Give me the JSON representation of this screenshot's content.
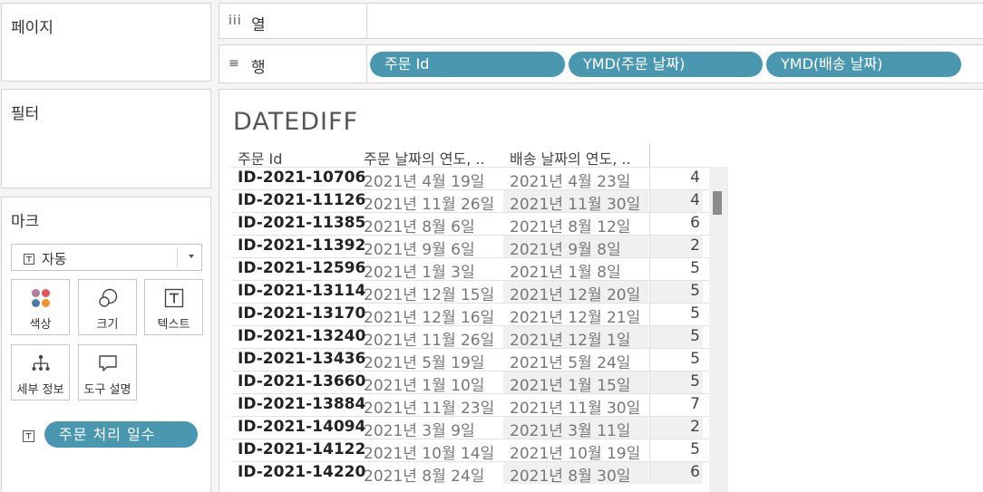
{
  "left_panel": {
    "pages_title": "페이지",
    "filters_title": "필터",
    "marks": {
      "title": "마크",
      "mark_type": "자동",
      "buttons": {
        "color": "색상",
        "size": "크기",
        "text": "텍스트",
        "detail": "세부 정보",
        "tooltip": "도구 설명"
      },
      "field_pill": "주문 처리 일수"
    }
  },
  "shelves": {
    "columns": {
      "icon": "iii",
      "label": "열",
      "pills": []
    },
    "rows": {
      "icon": "≡",
      "label": "행",
      "pills": [
        "주문 Id",
        "YMD(주문 날짜)",
        "YMD(배송 날짜)"
      ]
    }
  },
  "viz": {
    "title": "DATEDIFF",
    "headers": [
      "주문 Id",
      "주문 날짜의 연도, ..",
      "배송 날짜의 연도, .."
    ],
    "rows": [
      {
        "id": "ID-2021-10706",
        "order_date": "2021년 4월 19일",
        "ship_date": "2021년 4월 23일",
        "value": "4"
      },
      {
        "id": "ID-2021-11126",
        "order_date": "2021년 11월 26일",
        "ship_date": "2021년 11월 30일",
        "value": "4"
      },
      {
        "id": "ID-2021-11385",
        "order_date": "2021년 8월 6일",
        "ship_date": "2021년 8월 12일",
        "value": "6"
      },
      {
        "id": "ID-2021-11392",
        "order_date": "2021년 9월 6일",
        "ship_date": "2021년 9월 8일",
        "value": "2"
      },
      {
        "id": "ID-2021-12596",
        "order_date": "2021년 1월 3일",
        "ship_date": "2021년 1월 8일",
        "value": "5"
      },
      {
        "id": "ID-2021-13114",
        "order_date": "2021년 12월 15일",
        "ship_date": "2021년 12월 20일",
        "value": "5"
      },
      {
        "id": "ID-2021-13170",
        "order_date": "2021년 12월 16일",
        "ship_date": "2021년 12월 21일",
        "value": "5"
      },
      {
        "id": "ID-2021-13240",
        "order_date": "2021년 11월 26일",
        "ship_date": "2021년 12월 1일",
        "value": "5"
      },
      {
        "id": "ID-2021-13436",
        "order_date": "2021년 5월 19일",
        "ship_date": "2021년 5월 24일",
        "value": "5"
      },
      {
        "id": "ID-2021-13660",
        "order_date": "2021년 1월 10일",
        "ship_date": "2021년 1월 15일",
        "value": "5"
      },
      {
        "id": "ID-2021-13884",
        "order_date": "2021년 11월 23일",
        "ship_date": "2021년 11월 30일",
        "value": "7"
      },
      {
        "id": "ID-2021-14094",
        "order_date": "2021년 3월 9일",
        "ship_date": "2021년 3월 11일",
        "value": "2"
      },
      {
        "id": "ID-2021-14122",
        "order_date": "2021년 10월 14일",
        "ship_date": "2021년 10월 19일",
        "value": "5"
      },
      {
        "id": "ID-2021-14220",
        "order_date": "2021년 8월 24일",
        "ship_date": "2021년 8월 30일",
        "value": "6"
      }
    ]
  },
  "colors": {
    "pill_bg": "#4a97b0",
    "panel_bg": "#ffffff",
    "app_bg": "#f5f5f5"
  }
}
